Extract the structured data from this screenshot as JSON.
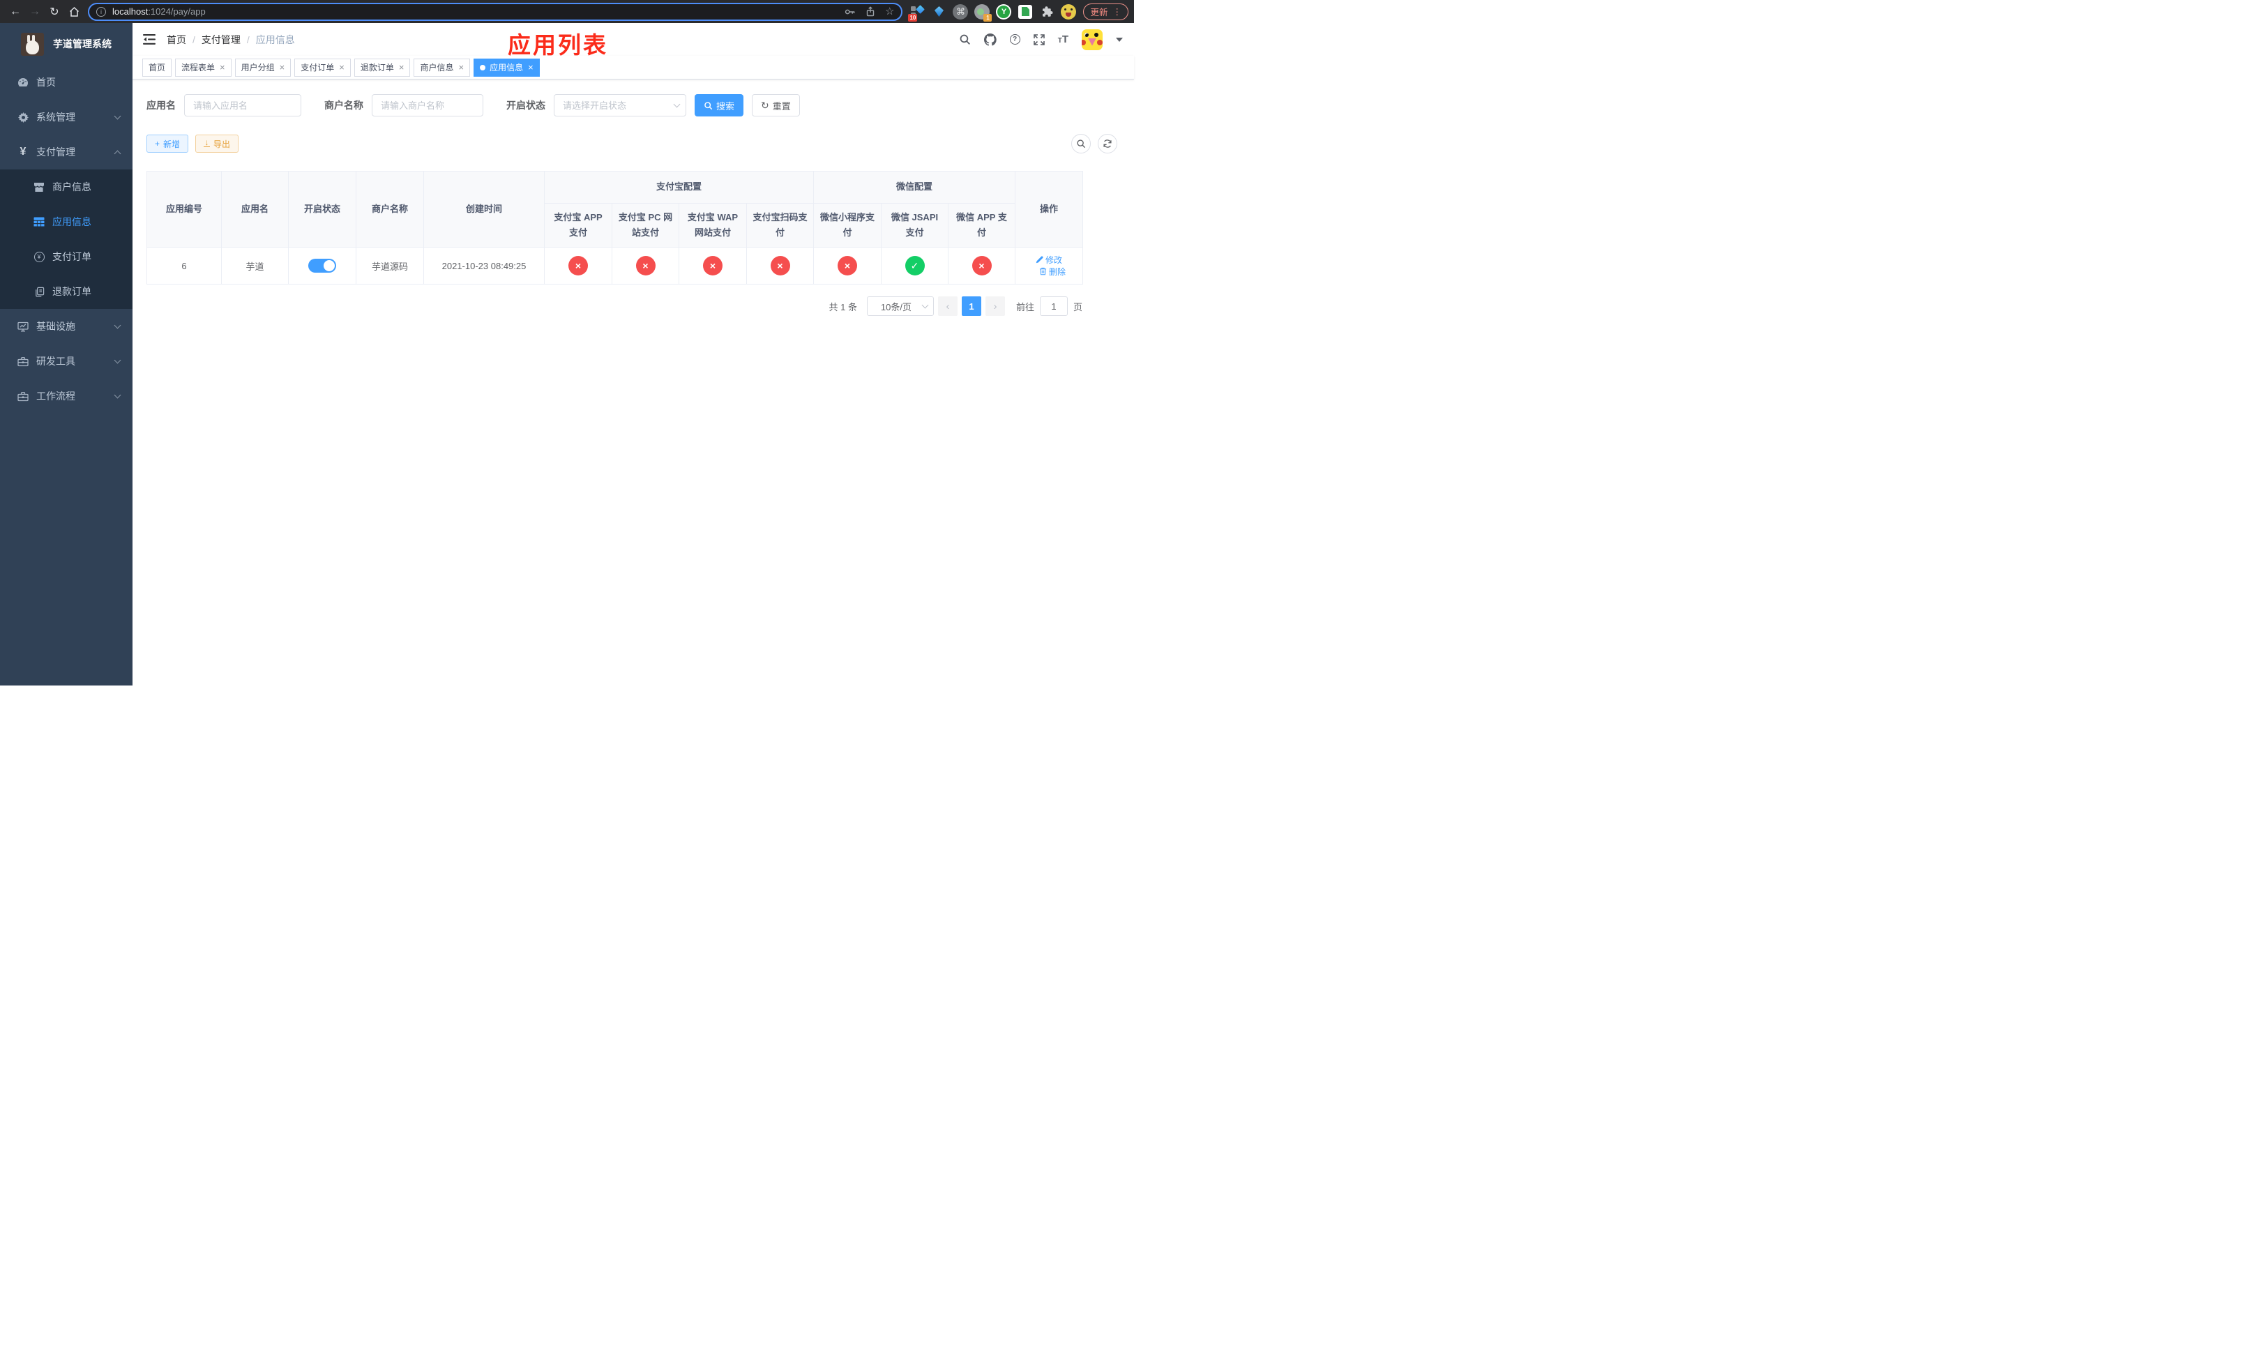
{
  "browser": {
    "url": {
      "host": "localhost",
      "rest": ":1024/pay/app"
    },
    "update_label": "更新",
    "ext_badge_grid": "10",
    "ext_badge_camera": "1",
    "ext_y_letter": "Y"
  },
  "icons": {
    "back": "←",
    "forward": "→",
    "reload": "↻",
    "info": "i",
    "star": "☆",
    "command": "⌘",
    "dots": "⋮",
    "yen": "¥",
    "plus": "+",
    "down_arrow": "↓",
    "reset_arrows": "↻",
    "prev": "‹",
    "next": "›",
    "help": "?",
    "cross": "×",
    "check": "✓"
  },
  "sidebar": {
    "title": "芋道管理系统",
    "menu": [
      {
        "label": "首页"
      },
      {
        "label": "系统管理"
      },
      {
        "label": "支付管理"
      },
      {
        "label": "商户信息"
      },
      {
        "label": "应用信息"
      },
      {
        "label": "支付订单"
      },
      {
        "label": "退款订单"
      },
      {
        "label": "基础设施"
      },
      {
        "label": "研发工具"
      },
      {
        "label": "工作流程"
      }
    ]
  },
  "navbar": {
    "breadcrumb": [
      "首页",
      "支付管理",
      "应用信息"
    ],
    "annotation": "应用列表"
  },
  "tags": [
    {
      "label": "首页"
    },
    {
      "label": "流程表单"
    },
    {
      "label": "用户分组"
    },
    {
      "label": "支付订单"
    },
    {
      "label": "退款订单"
    },
    {
      "label": "商户信息"
    },
    {
      "label": "应用信息"
    }
  ],
  "search": {
    "app_name_label": "应用名",
    "app_name_placeholder": "请输入应用名",
    "merchant_label": "商户名称",
    "merchant_placeholder": "请输入商户名称",
    "status_label": "开启状态",
    "status_placeholder": "请选择开启状态",
    "search_label": "搜索",
    "reset_label": "重置"
  },
  "toolbar": {
    "add_label": "新增",
    "export_label": "导出"
  },
  "table": {
    "headers": {
      "app_id": "应用编号",
      "app_name": "应用名",
      "status": "开启状态",
      "merchant": "商户名称",
      "create_time": "创建时间",
      "alipay_group": "支付宝配置",
      "wechat_group": "微信配置",
      "actions": "操作",
      "channels": [
        "支付宝 APP 支付",
        "支付宝 PC 网站支付",
        "支付宝 WAP 网站支付",
        "支付宝扫码支付",
        "微信小程序支付",
        "微信 JSAPI 支付",
        "微信 APP 支付"
      ]
    },
    "row": {
      "app_id": "6",
      "app_name": "芋道",
      "merchant": "芋道源码",
      "create_time": "2021-10-23 08:49:25",
      "channel_states": [
        "off",
        "off",
        "off",
        "off",
        "off",
        "on",
        "off"
      ],
      "edit_label": "修改",
      "delete_label": "删除"
    }
  },
  "pagination": {
    "total": "共 1 条",
    "page_size": "10条/页",
    "current_page": "1",
    "goto_label": "前往",
    "goto_value": "1",
    "page_label": "页"
  },
  "colors": {
    "accent": "#409eff",
    "success": "#13ce66",
    "danger": "#f54e4e",
    "warning": "#e6a23c",
    "sidebar_bg": "#304156",
    "submenu_bg": "#1f2d3d"
  }
}
